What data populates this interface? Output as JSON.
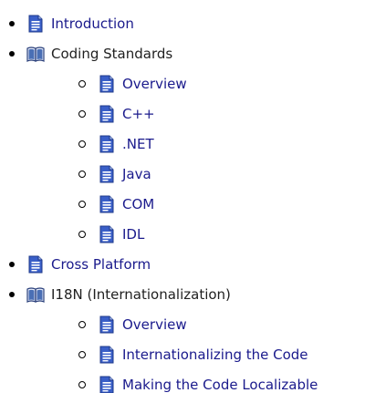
{
  "tree": {
    "items": [
      {
        "label": "Introduction",
        "icon": "document-icon",
        "kind": "page"
      },
      {
        "label": "Coding Standards",
        "icon": "open-book-icon",
        "kind": "folder",
        "children": [
          {
            "label": "Overview",
            "icon": "document-icon"
          },
          {
            "label": "C++",
            "icon": "document-icon"
          },
          {
            "label": ".NET",
            "icon": "document-icon"
          },
          {
            "label": "Java",
            "icon": "document-icon"
          },
          {
            "label": "COM",
            "icon": "document-icon"
          },
          {
            "label": "IDL",
            "icon": "document-icon"
          }
        ]
      },
      {
        "label": "Cross Platform",
        "icon": "document-icon",
        "kind": "page"
      },
      {
        "label": "I18N (Internationalization)",
        "icon": "open-book-icon",
        "kind": "folder",
        "children": [
          {
            "label": "Overview",
            "icon": "document-icon"
          },
          {
            "label": "Internationalizing the Code",
            "icon": "document-icon"
          },
          {
            "label": "Making the Code Localizable",
            "icon": "document-icon"
          }
        ]
      }
    ]
  },
  "colors": {
    "link": "#1a1a8c",
    "folder_text": "#1f1f1f",
    "doc_icon_fill": "#3a5fc8",
    "doc_icon_lines": "#ffffff",
    "book_icon": "#4a6fb5"
  }
}
